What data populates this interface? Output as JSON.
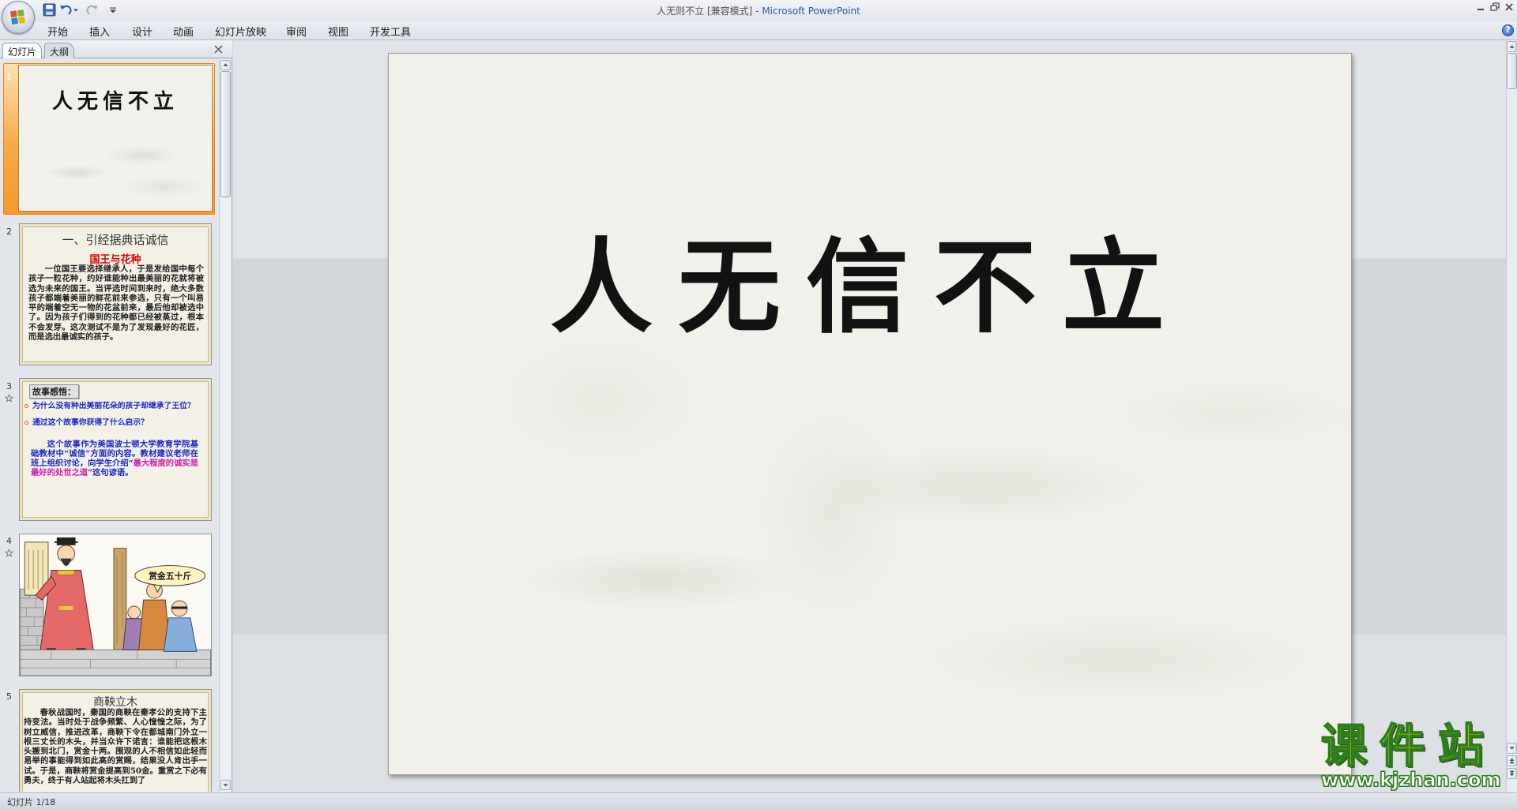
{
  "window": {
    "doc_title": "人无则不立 [兼容模式]",
    "separator": " - ",
    "app_name": "Microsoft PowerPoint"
  },
  "icons": {
    "office_button": "office-logo-icon",
    "quick_access": [
      "save-icon",
      "undo-icon",
      "undo-dropdown-icon",
      "redo-icon",
      "customize-toolbar-icon"
    ],
    "window_controls": [
      "minimize-icon",
      "restore-icon",
      "close-icon"
    ],
    "help": "help-icon",
    "animation_marker": "star-icon"
  },
  "ribbon": {
    "tabs": [
      {
        "label": "开始"
      },
      {
        "label": "插入"
      },
      {
        "label": "设计"
      },
      {
        "label": "动画"
      },
      {
        "label": "幻灯片放映"
      },
      {
        "label": "审阅"
      },
      {
        "label": "视图"
      },
      {
        "label": "开发工具"
      }
    ]
  },
  "left_pane": {
    "tabs": [
      {
        "label": "幻灯片",
        "active": true
      },
      {
        "label": "大纲",
        "active": false
      }
    ]
  },
  "slides": [
    {
      "number": "1",
      "selected": true,
      "title": "人无信不立"
    },
    {
      "number": "2",
      "heading": "一、引经据典话诚信",
      "subtitle": "国王与花种",
      "body": "一位国王要选择继承人，于是发给国中每个孩子一粒花种，约好谁能种出最美丽的花就将被选为未来的国王。当评选时间到来时，绝大多数孩子都端着美丽的鲜花前来参选，只有一个叫易平的端着空无一物的花盆前来，最后他却被选中了。因为孩子们得到的花种都已经被蒸过，根本不会发芽。这次测试不是为了发现最好的花匠，而是选出最诚实的孩子。"
    },
    {
      "number": "3",
      "has_animation": true,
      "heading": "故事感悟：",
      "bullets": [
        "为什么没有种出美丽花朵的孩子却继承了王位？",
        "通过这个故事你获得了什么启示？"
      ],
      "body_before": "这个故事作为美国波士顿大学教育学院基础教材中“诚信”方面的内容。教材建议老师在班上组织讨论，向学生介绍“",
      "body_highlight": "最大程度的诚实是最好的处世之道",
      "body_after": "”这句谚语。"
    },
    {
      "number": "4",
      "has_animation": true,
      "bubble_text": "赏金五十斤"
    },
    {
      "number": "5",
      "heading": "商鞅立木",
      "body": "春秋战国时，秦国的商鞅在秦孝公的支持下主持变法。当时处于战争频繁、人心惶惶之际，为了树立威信，推进改革，商鞅下令在都城南门外立一根三丈长的木头，并当众许下诺言：谁能把这根木头搬到北门，赏金十两。围观的人不相信如此轻而易举的事能得到如此高的赏赐，结果没人肯出手一试。于是，商鞅将赏金提高到50金。重赏之下必有勇夫，终于有人站起将木头扛到了"
    }
  ],
  "main_slide": {
    "title": "人无信不立"
  },
  "status_bar": {
    "slide_indicator": "幻灯片 1/18"
  },
  "watermark": {
    "name": "课件站",
    "url": "www.kjzhan.com"
  },
  "colors": {
    "selection_orange": "#f7a944",
    "heading_red": "#e00000",
    "text_blue": "#1b27c9",
    "highlight_magenta": "#d21fb0",
    "watermark_yellow": "#f4e800",
    "watermark_green": "#2e7d1e",
    "app_name_blue": "#2b5ca6"
  }
}
